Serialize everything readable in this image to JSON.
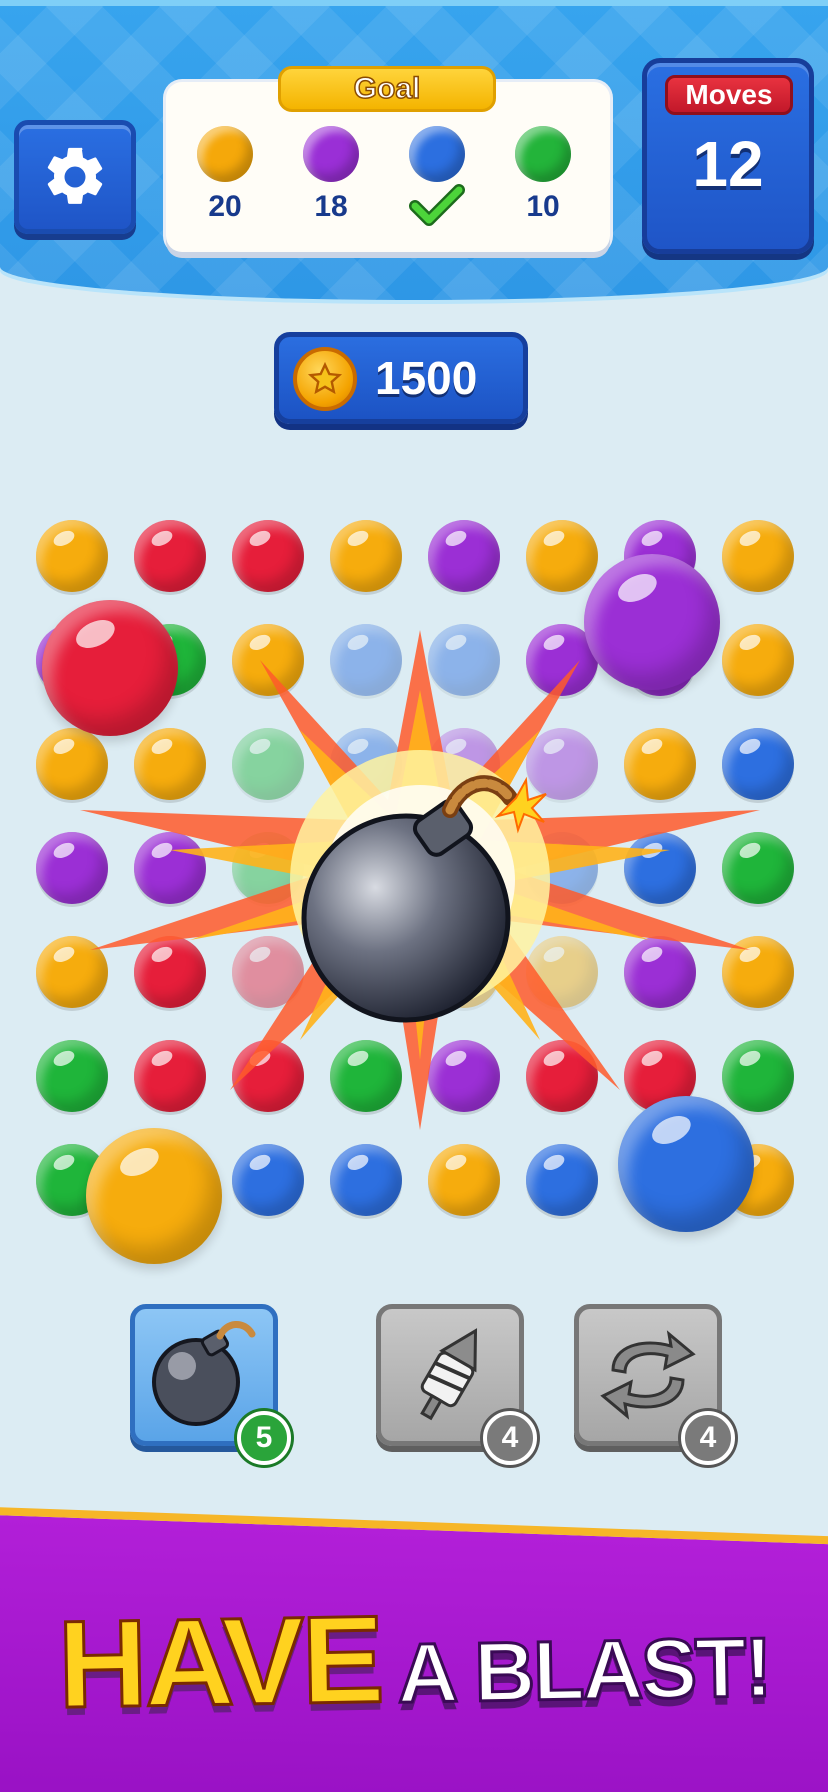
{
  "header": {
    "settings_icon": "gear-icon",
    "goal": {
      "title": "Goal",
      "items": [
        {
          "color": "#f5a80a",
          "count": "20",
          "done": false
        },
        {
          "color": "#9a2fd6",
          "count": "18",
          "done": false
        },
        {
          "color": "#2c6fe0",
          "count": "",
          "done": true
        },
        {
          "color": "#23b43a",
          "count": "10",
          "done": false
        }
      ]
    },
    "moves": {
      "label": "Moves",
      "value": "12"
    }
  },
  "coins": {
    "icon": "star-coin-icon",
    "value": "1500"
  },
  "board": {
    "colors": {
      "orange": "#f6ac0d",
      "red": "#e61e3a",
      "purple": "#9b2fd5",
      "blue": "#2d6fe0",
      "green": "#1fb53a"
    },
    "rows": [
      [
        "orange",
        "red",
        "red",
        "orange",
        "purple",
        "orange",
        "purple",
        "orange"
      ],
      [
        "purple",
        "green",
        "orange",
        "blue",
        "blue",
        "purple",
        "purple",
        "orange"
      ],
      [
        "orange",
        "orange",
        "green",
        "blue",
        "purple",
        "purple",
        "orange",
        "blue"
      ],
      [
        "purple",
        "purple",
        "green",
        "blue",
        "blue",
        "blue",
        "blue",
        "green"
      ],
      [
        "orange",
        "red",
        "red",
        "orange",
        "orange",
        "orange",
        "purple",
        "orange"
      ],
      [
        "green",
        "red",
        "red",
        "green",
        "purple",
        "red",
        "red",
        "green"
      ],
      [
        "green",
        "orange",
        "blue",
        "blue",
        "orange",
        "blue",
        "blue",
        "orange"
      ]
    ],
    "explosion_item": "bomb-icon"
  },
  "boosters": [
    {
      "name": "bomb",
      "icon": "bomb-icon",
      "count": "5",
      "selected": true
    },
    {
      "name": "drill",
      "icon": "drill-icon",
      "count": "4",
      "selected": false
    },
    {
      "name": "shuffle",
      "icon": "shuffle-icon",
      "count": "4",
      "selected": false
    }
  ],
  "banner": {
    "line_big": "HAVE",
    "line_small": "A BLAST!"
  }
}
